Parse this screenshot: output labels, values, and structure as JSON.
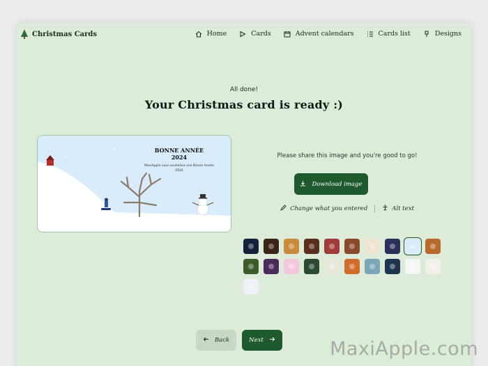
{
  "nav": {
    "brand": "Christmas Cards",
    "links": [
      {
        "label": "Home",
        "icon": "home-icon"
      },
      {
        "label": "Cards",
        "icon": "play-icon"
      },
      {
        "label": "Advent calendars",
        "icon": "calendar-icon"
      },
      {
        "label": "Cards list",
        "icon": "list-icon"
      },
      {
        "label": "Designs",
        "icon": "brush-icon"
      }
    ]
  },
  "header": {
    "subtitle": "All done!",
    "title": "Your Christmas card is ready :)"
  },
  "card": {
    "title_line1": "BONNE ANNÉE",
    "title_line2": "2024",
    "message": "MaxiApple vous souhaitez une Bonne Année 2024"
  },
  "share": {
    "text": "Please share this image and you're good to go!",
    "download_label": "Download image",
    "change_label": "Change what you entered",
    "alt_label": "Alt text"
  },
  "designs": [
    {
      "name": "design-night",
      "bg": "#14213a"
    },
    {
      "name": "design-fireplace",
      "bg": "#3a2416"
    },
    {
      "name": "design-cookies",
      "bg": "#c98a3b"
    },
    {
      "name": "design-chocolate",
      "bg": "#5a2f1c"
    },
    {
      "name": "design-candycane",
      "bg": "#a23a3a"
    },
    {
      "name": "design-gingerbread-house",
      "bg": "#8a4a2a"
    },
    {
      "name": "design-wreath",
      "bg": "#efe4d2"
    },
    {
      "name": "design-reindeer",
      "bg": "#2b2f5a"
    },
    {
      "name": "design-snow-hill",
      "bg": "#d9ecfb"
    },
    {
      "name": "design-gingerbread-man",
      "bg": "#b86a2c"
    },
    {
      "name": "design-ornament",
      "bg": "#3d5a2a"
    },
    {
      "name": "design-presents",
      "bg": "#4a2a5a"
    },
    {
      "name": "design-pink-mountains",
      "bg": "#f3c8dc"
    },
    {
      "name": "design-village",
      "bg": "#2a4a34"
    },
    {
      "name": "design-owl",
      "bg": "#e9e6dc"
    },
    {
      "name": "design-candy",
      "bg": "#d06b2a"
    },
    {
      "name": "design-blue-pattern",
      "bg": "#7aa6b8"
    },
    {
      "name": "design-night-town",
      "bg": "#1e3550"
    },
    {
      "name": "design-forest",
      "bg": "#f4f7f4"
    },
    {
      "name": "design-reindeer-white",
      "bg": "#f2f0ea"
    },
    {
      "name": "design-penguin",
      "bg": "#eef2f6"
    }
  ],
  "selected_design": 8,
  "footer": {
    "back_label": "Back",
    "next_label": "Next"
  },
  "watermark": "MaxiApple.com",
  "colors": {
    "accent": "#1e5a2d",
    "background": "#dcecd9"
  }
}
